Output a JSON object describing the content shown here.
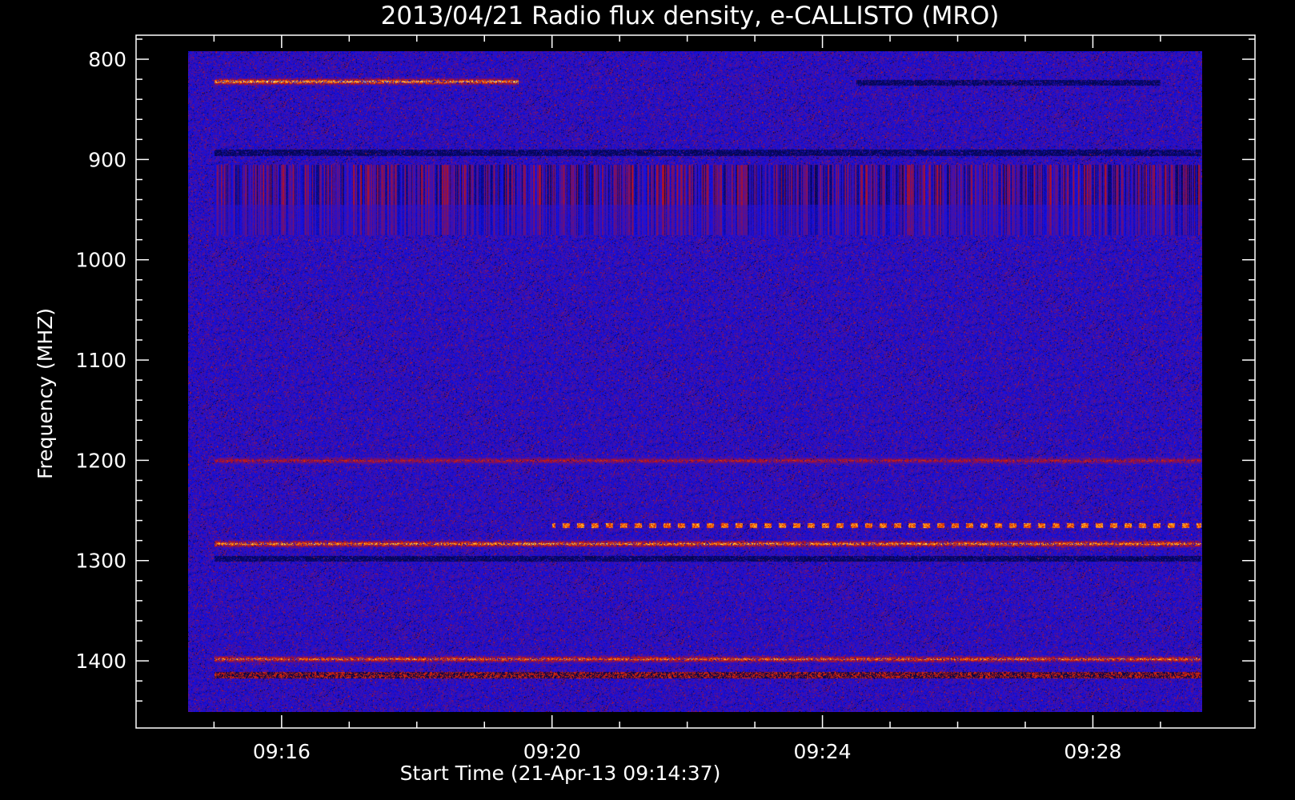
{
  "chart_data": {
    "type": "heatmap",
    "title": "2013/04/21  Radio flux density, e-CALLISTO (MRO)",
    "xlabel": "Start Time (21-Apr-13 09:14:37)",
    "ylabel": "Frequency (MHZ)",
    "x_range": [
      "09:14:37",
      "09:29:37"
    ],
    "y_range_mhz": [
      792,
      1451
    ],
    "y_axis_inverted": true,
    "x_ticks": [
      {
        "label": "09:16",
        "minutes": 16
      },
      {
        "label": "09:20",
        "minutes": 20
      },
      {
        "label": "09:24",
        "minutes": 24
      },
      {
        "label": "09:28",
        "minutes": 28
      }
    ],
    "y_ticks": [
      {
        "label": "800",
        "value": 800
      },
      {
        "label": "900",
        "value": 900
      },
      {
        "label": "1000",
        "value": 1000
      },
      {
        "label": "1100",
        "value": 1100
      },
      {
        "label": "1200",
        "value": 1200
      },
      {
        "label": "1300",
        "value": 1300
      },
      {
        "label": "1400",
        "value": 1400
      }
    ],
    "background_level_color": "#1a10e0",
    "colormap": [
      "#000000",
      "#1010e8",
      "#c01010",
      "#ff7000",
      "#ffff60",
      "#ffffff"
    ],
    "features": [
      {
        "freq_mhz": 822,
        "kind": "bright band",
        "t_start_min": 15.0,
        "t_end_min": 19.5,
        "intensity": 0.85
      },
      {
        "freq_mhz": 823,
        "kind": "dark band",
        "t_start_min": 24.5,
        "t_end_min": 29.0,
        "intensity": 0.05
      },
      {
        "freq_mhz": 893,
        "kind": "dark line",
        "t_start_min": 15.0,
        "t_end_min": 29.6,
        "intensity": 0.0
      },
      {
        "freq_mhz": 930,
        "kind": "striped region",
        "t_start_min": 15.0,
        "t_end_min": 29.6,
        "intensity": 0.5
      },
      {
        "freq_mhz": 1200,
        "kind": "weak line",
        "t_start_min": 15.0,
        "t_end_min": 29.6,
        "intensity": 0.55
      },
      {
        "freq_mhz": 1265,
        "kind": "dotted bright line",
        "t_start_min": 20.0,
        "t_end_min": 29.6,
        "intensity": 0.9
      },
      {
        "freq_mhz": 1283,
        "kind": "bright band",
        "t_start_min": 15.0,
        "t_end_min": 29.6,
        "intensity": 0.8
      },
      {
        "freq_mhz": 1298,
        "kind": "dark line",
        "t_start_min": 15.0,
        "t_end_min": 29.6,
        "intensity": 0.05
      },
      {
        "freq_mhz": 1398,
        "kind": "bright band",
        "t_start_min": 15.0,
        "t_end_min": 29.6,
        "intensity": 0.75
      },
      {
        "freq_mhz": 1414,
        "kind": "mixed band",
        "t_start_min": 15.0,
        "t_end_min": 29.6,
        "intensity": 0.6
      }
    ],
    "grid": false,
    "legend": "none"
  }
}
